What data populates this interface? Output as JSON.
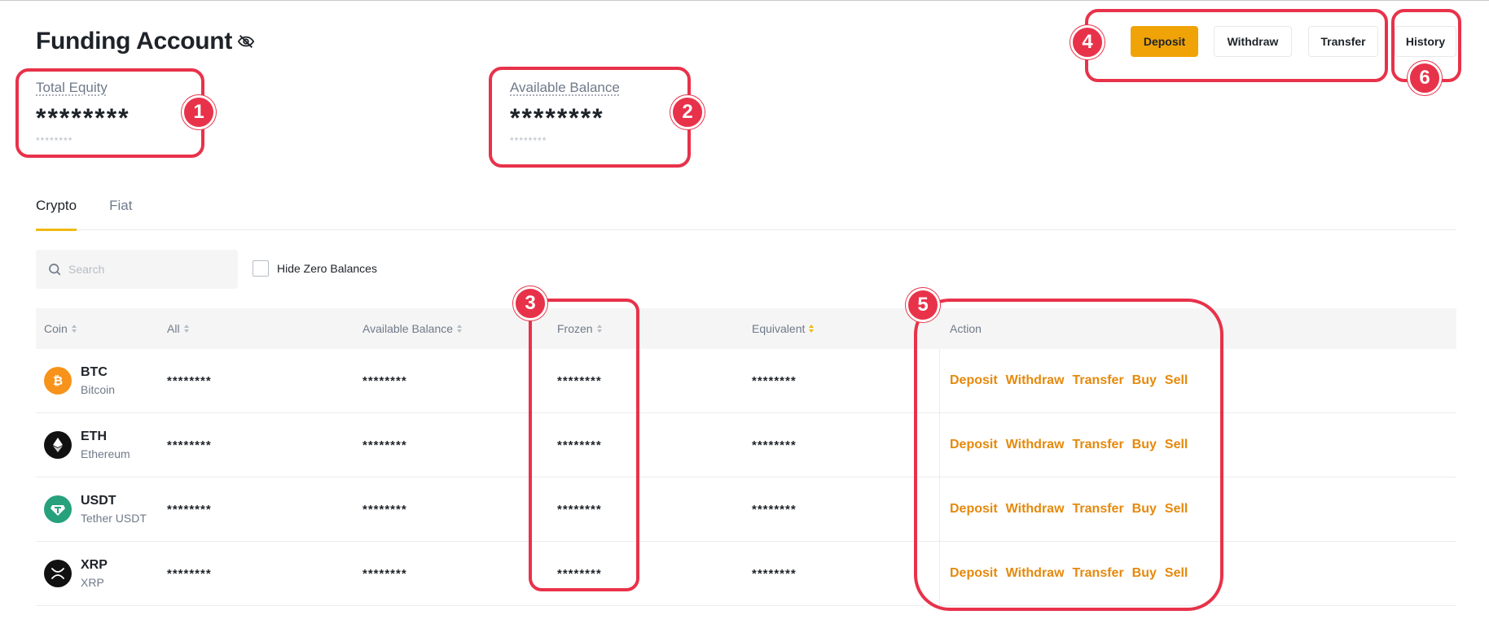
{
  "header": {
    "title": "Funding Account"
  },
  "summary": {
    "total_equity": {
      "label": "Total Equity",
      "value": "********",
      "sub": "********"
    },
    "available_balance": {
      "label": "Available Balance",
      "value": "********",
      "sub": "********"
    }
  },
  "top_actions": {
    "deposit": "Deposit",
    "withdraw": "Withdraw",
    "transfer": "Transfer",
    "history": "History"
  },
  "tabs": [
    {
      "label": "Crypto",
      "active": true
    },
    {
      "label": "Fiat",
      "active": false
    }
  ],
  "search": {
    "placeholder": "Search"
  },
  "filter": {
    "hide_zero_label": "Hide Zero Balances",
    "checked": false
  },
  "table": {
    "columns": {
      "coin": "Coin",
      "all": "All",
      "available": "Available Balance",
      "frozen": "Frozen",
      "equivalent": "Equivalent",
      "action": "Action"
    },
    "rows": [
      {
        "symbol": "BTC",
        "name": "Bitcoin",
        "all": "********",
        "available": "********",
        "frozen": "********",
        "equivalent": "********",
        "logo": "bitcoin-icon",
        "color": "#f7931a"
      },
      {
        "symbol": "ETH",
        "name": "Ethereum",
        "all": "********",
        "available": "********",
        "frozen": "********",
        "equivalent": "********",
        "logo": "ethereum-icon",
        "color": "#111111"
      },
      {
        "symbol": "USDT",
        "name": "Tether USDT",
        "all": "********",
        "available": "********",
        "frozen": "********",
        "equivalent": "********",
        "logo": "tether-icon",
        "color": "#26a17b"
      },
      {
        "symbol": "XRP",
        "name": "XRP",
        "all": "********",
        "available": "********",
        "frozen": "********",
        "equivalent": "********",
        "logo": "xrp-icon",
        "color": "#111111"
      }
    ],
    "row_actions": {
      "deposit": "Deposit",
      "withdraw": "Withdraw",
      "transfer": "Transfer",
      "buy": "Buy",
      "sell": "Sell"
    }
  },
  "callouts": {
    "one": "1",
    "two": "2",
    "three": "3",
    "four": "4",
    "five": "5",
    "six": "6"
  },
  "colors": {
    "accent": "#f0a306",
    "action_text": "#e5890c",
    "callout": "#e8324a"
  }
}
